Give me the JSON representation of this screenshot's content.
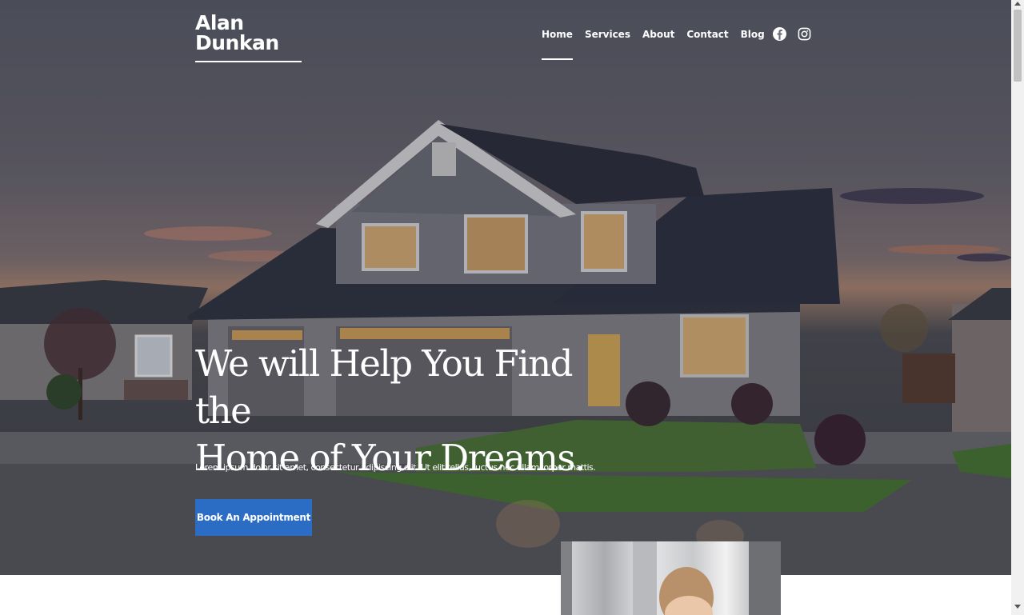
{
  "site": {
    "logo_line1": "Alan",
    "logo_line2": "Dunkan"
  },
  "nav": {
    "items": [
      "Home",
      "Services",
      "About",
      "Contact",
      "Blog"
    ],
    "active": "Home",
    "social_icons": [
      "facebook-icon",
      "instagram-icon"
    ]
  },
  "hero": {
    "headline_line1": "We will Help You Find the",
    "headline_line2": "Home of Your Dreams.",
    "subtext": "Lorem ipsum dolor sit amet, consectetur adipiscing elit. Ut elit tellus, luctus nec ullamcorper mattis.",
    "cta_label": "Book An Appointment"
  },
  "colors": {
    "accent": "#2b6cc4",
    "text_on_hero": "#ffffff"
  }
}
